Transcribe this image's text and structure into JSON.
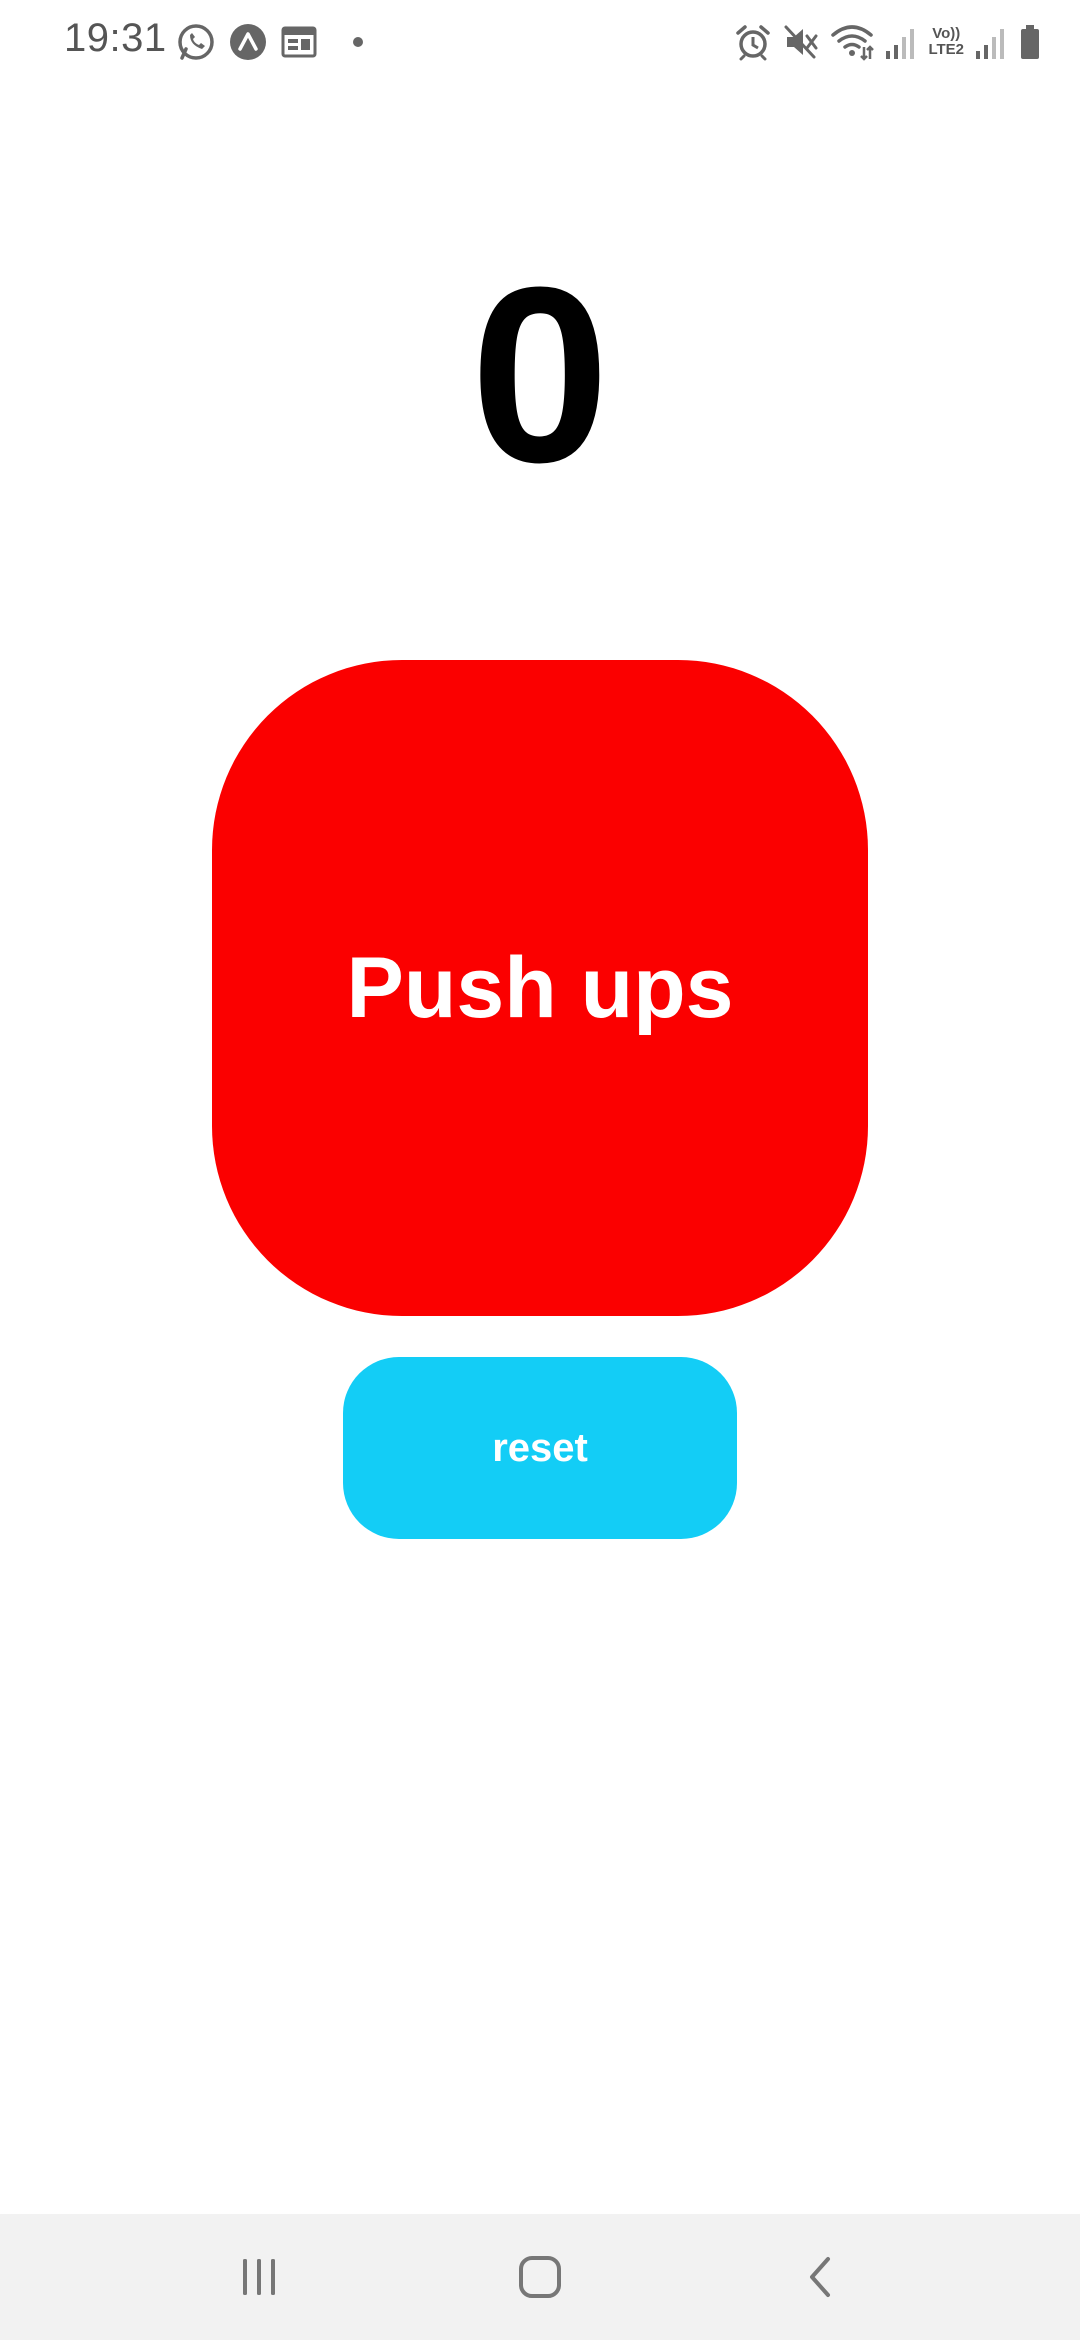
{
  "status_bar": {
    "time": "19:31",
    "left_icons": [
      "whatsapp-icon",
      "expo-icon",
      "calendar-icon",
      "notification-dot-icon"
    ],
    "right_icons": [
      "alarm-icon",
      "mute-icon",
      "wifi-icon",
      "signal-icon",
      "volte-lte2-icon",
      "signal-icon",
      "battery-icon"
    ],
    "volte_top": "Vo))",
    "volte_bottom": "LTE2"
  },
  "counter": {
    "value": "0"
  },
  "pushups_button": {
    "label": "Push ups",
    "color": "#fb0000"
  },
  "reset_button": {
    "label": "reset",
    "color": "#13cdf6"
  },
  "nav_bar": {
    "items": [
      "recents-icon",
      "home-icon",
      "back-icon"
    ]
  }
}
